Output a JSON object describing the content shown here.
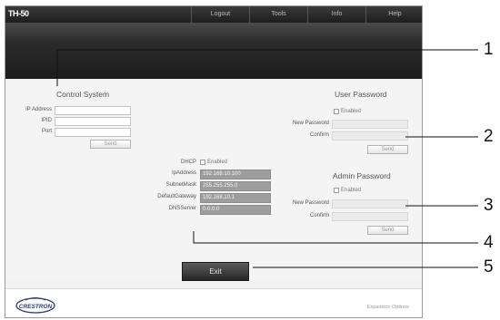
{
  "brand": "TH-50",
  "nav": [
    "Logout",
    "Tools",
    "Info",
    "Help"
  ],
  "control_system": {
    "title": "Control System",
    "labels": [
      "IP Address",
      "IPID",
      "Port"
    ],
    "send": "Send"
  },
  "network": {
    "dhcp_label": "DHCP",
    "dhcp_enabled_label": "Enabled",
    "rows": [
      {
        "label": "IpAddress",
        "value": "192.168.10.100"
      },
      {
        "label": "SubnetMask",
        "value": "255.255.255.0"
      },
      {
        "label": "DefaultGateway",
        "value": "192.168.10.1"
      },
      {
        "label": "DNSServer",
        "value": "0.0.0.0"
      }
    ]
  },
  "user_password": {
    "title": "User Password",
    "enabled_label": "Enabled",
    "new_password_label": "New Password",
    "confirm_label": "Confirm",
    "send": "Send"
  },
  "admin_password": {
    "title": "Admin Password",
    "enabled_label": "Enabled",
    "new_password_label": "New Password",
    "confirm_label": "Confirm",
    "send": "Send"
  },
  "exit": "Exit",
  "footer": {
    "logo": "CRESTRON",
    "expansion": "Expansion Options"
  },
  "callouts": [
    "1",
    "2",
    "3",
    "4",
    "5"
  ]
}
